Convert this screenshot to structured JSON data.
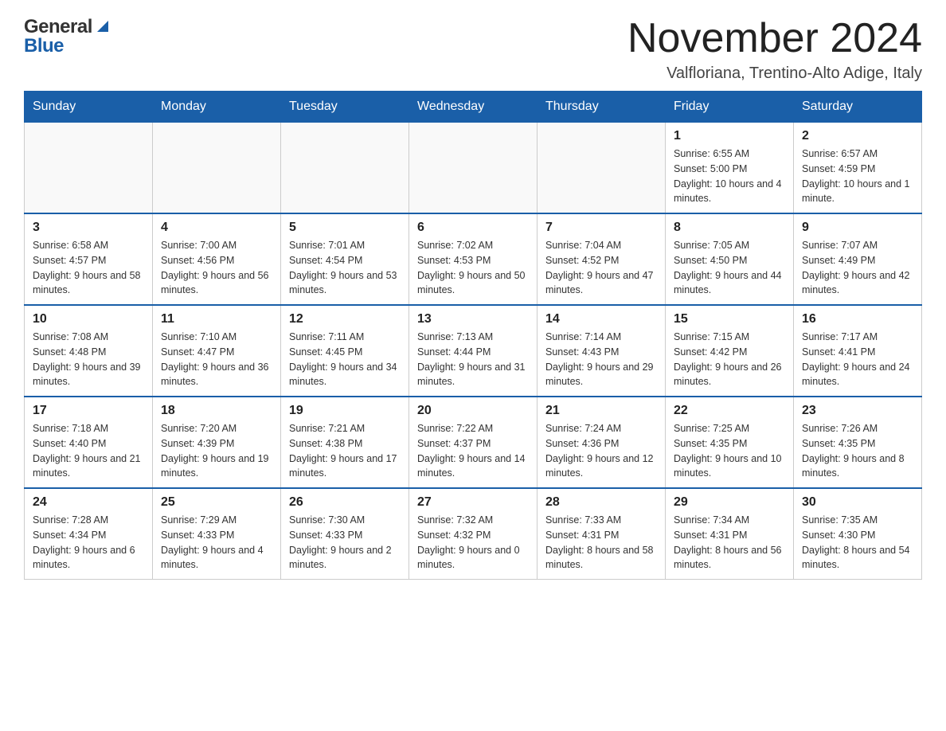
{
  "header": {
    "title": "November 2024",
    "subtitle": "Valfloriana, Trentino-Alto Adige, Italy",
    "logo": {
      "general": "General",
      "blue": "Blue"
    }
  },
  "days_of_week": [
    "Sunday",
    "Monday",
    "Tuesday",
    "Wednesday",
    "Thursday",
    "Friday",
    "Saturday"
  ],
  "weeks": [
    [
      {
        "day": "",
        "info": ""
      },
      {
        "day": "",
        "info": ""
      },
      {
        "day": "",
        "info": ""
      },
      {
        "day": "",
        "info": ""
      },
      {
        "day": "",
        "info": ""
      },
      {
        "day": "1",
        "info": "Sunrise: 6:55 AM\nSunset: 5:00 PM\nDaylight: 10 hours and 4 minutes."
      },
      {
        "day": "2",
        "info": "Sunrise: 6:57 AM\nSunset: 4:59 PM\nDaylight: 10 hours and 1 minute."
      }
    ],
    [
      {
        "day": "3",
        "info": "Sunrise: 6:58 AM\nSunset: 4:57 PM\nDaylight: 9 hours and 58 minutes."
      },
      {
        "day": "4",
        "info": "Sunrise: 7:00 AM\nSunset: 4:56 PM\nDaylight: 9 hours and 56 minutes."
      },
      {
        "day": "5",
        "info": "Sunrise: 7:01 AM\nSunset: 4:54 PM\nDaylight: 9 hours and 53 minutes."
      },
      {
        "day": "6",
        "info": "Sunrise: 7:02 AM\nSunset: 4:53 PM\nDaylight: 9 hours and 50 minutes."
      },
      {
        "day": "7",
        "info": "Sunrise: 7:04 AM\nSunset: 4:52 PM\nDaylight: 9 hours and 47 minutes."
      },
      {
        "day": "8",
        "info": "Sunrise: 7:05 AM\nSunset: 4:50 PM\nDaylight: 9 hours and 44 minutes."
      },
      {
        "day": "9",
        "info": "Sunrise: 7:07 AM\nSunset: 4:49 PM\nDaylight: 9 hours and 42 minutes."
      }
    ],
    [
      {
        "day": "10",
        "info": "Sunrise: 7:08 AM\nSunset: 4:48 PM\nDaylight: 9 hours and 39 minutes."
      },
      {
        "day": "11",
        "info": "Sunrise: 7:10 AM\nSunset: 4:47 PM\nDaylight: 9 hours and 36 minutes."
      },
      {
        "day": "12",
        "info": "Sunrise: 7:11 AM\nSunset: 4:45 PM\nDaylight: 9 hours and 34 minutes."
      },
      {
        "day": "13",
        "info": "Sunrise: 7:13 AM\nSunset: 4:44 PM\nDaylight: 9 hours and 31 minutes."
      },
      {
        "day": "14",
        "info": "Sunrise: 7:14 AM\nSunset: 4:43 PM\nDaylight: 9 hours and 29 minutes."
      },
      {
        "day": "15",
        "info": "Sunrise: 7:15 AM\nSunset: 4:42 PM\nDaylight: 9 hours and 26 minutes."
      },
      {
        "day": "16",
        "info": "Sunrise: 7:17 AM\nSunset: 4:41 PM\nDaylight: 9 hours and 24 minutes."
      }
    ],
    [
      {
        "day": "17",
        "info": "Sunrise: 7:18 AM\nSunset: 4:40 PM\nDaylight: 9 hours and 21 minutes."
      },
      {
        "day": "18",
        "info": "Sunrise: 7:20 AM\nSunset: 4:39 PM\nDaylight: 9 hours and 19 minutes."
      },
      {
        "day": "19",
        "info": "Sunrise: 7:21 AM\nSunset: 4:38 PM\nDaylight: 9 hours and 17 minutes."
      },
      {
        "day": "20",
        "info": "Sunrise: 7:22 AM\nSunset: 4:37 PM\nDaylight: 9 hours and 14 minutes."
      },
      {
        "day": "21",
        "info": "Sunrise: 7:24 AM\nSunset: 4:36 PM\nDaylight: 9 hours and 12 minutes."
      },
      {
        "day": "22",
        "info": "Sunrise: 7:25 AM\nSunset: 4:35 PM\nDaylight: 9 hours and 10 minutes."
      },
      {
        "day": "23",
        "info": "Sunrise: 7:26 AM\nSunset: 4:35 PM\nDaylight: 9 hours and 8 minutes."
      }
    ],
    [
      {
        "day": "24",
        "info": "Sunrise: 7:28 AM\nSunset: 4:34 PM\nDaylight: 9 hours and 6 minutes."
      },
      {
        "day": "25",
        "info": "Sunrise: 7:29 AM\nSunset: 4:33 PM\nDaylight: 9 hours and 4 minutes."
      },
      {
        "day": "26",
        "info": "Sunrise: 7:30 AM\nSunset: 4:33 PM\nDaylight: 9 hours and 2 minutes."
      },
      {
        "day": "27",
        "info": "Sunrise: 7:32 AM\nSunset: 4:32 PM\nDaylight: 9 hours and 0 minutes."
      },
      {
        "day": "28",
        "info": "Sunrise: 7:33 AM\nSunset: 4:31 PM\nDaylight: 8 hours and 58 minutes."
      },
      {
        "day": "29",
        "info": "Sunrise: 7:34 AM\nSunset: 4:31 PM\nDaylight: 8 hours and 56 minutes."
      },
      {
        "day": "30",
        "info": "Sunrise: 7:35 AM\nSunset: 4:30 PM\nDaylight: 8 hours and 54 minutes."
      }
    ]
  ]
}
